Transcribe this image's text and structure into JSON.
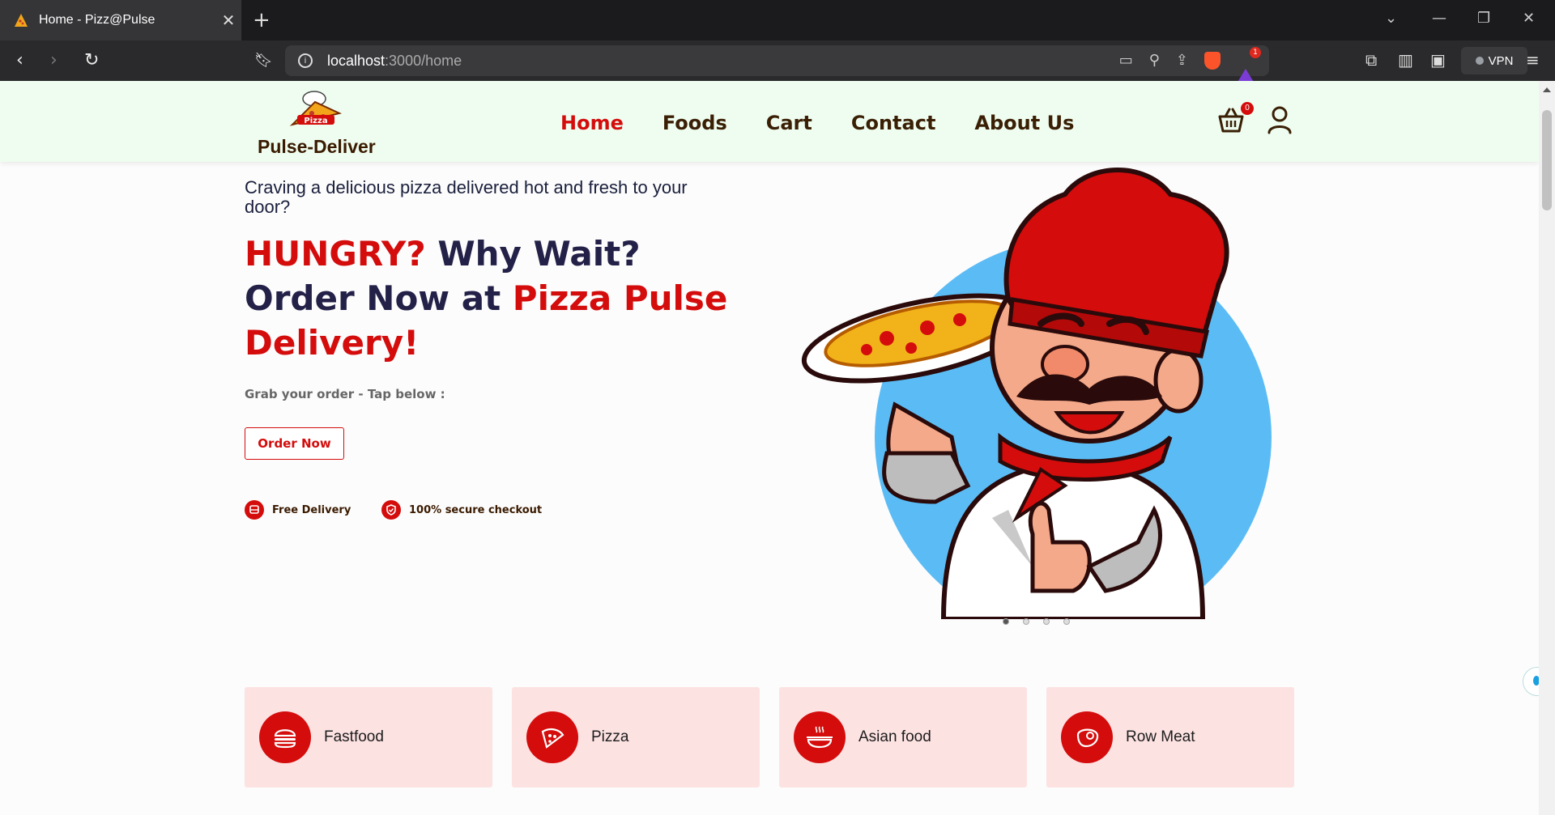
{
  "browser": {
    "tab_title": "Home - Pizz@Pulse",
    "new_tab_symbol": "+",
    "url_host": "localhost",
    "url_path": ":3000/home",
    "vpn_label": "VPN",
    "rewards_badge": "1"
  },
  "header": {
    "logo_text": "Pulse-Deliver",
    "nav": [
      {
        "label": "Home"
      },
      {
        "label": "Foods"
      },
      {
        "label": "Cart"
      },
      {
        "label": "Contact"
      },
      {
        "label": "About Us"
      }
    ],
    "cart_count": "0",
    "colors": {
      "accent": "#d40c0c",
      "header_bg": "#eefdf0",
      "dark_text": "#232148"
    }
  },
  "hero": {
    "subtitle": "Craving a delicious pizza delivered hot and fresh to your door?",
    "title_part1": "HUNGRY?",
    "title_part2": " Why Wait?",
    "title_part3": "Order Now at ",
    "title_part4": "Pizza Pulse Delivery!",
    "grab_text": "Grab your order - Tap below :",
    "order_button": "Order Now",
    "perks": [
      {
        "label": "Free Delivery",
        "icon": "delivery-icon"
      },
      {
        "label": "100% secure checkout",
        "icon": "shield-check-icon"
      }
    ],
    "carousel_slides": 4,
    "carousel_active": 1
  },
  "categories": [
    {
      "label": "Fastfood",
      "icon": "burger-icon"
    },
    {
      "label": "Pizza",
      "icon": "pizza-slice-icon"
    },
    {
      "label": "Asian food",
      "icon": "dish-icon"
    },
    {
      "label": "Row Meat",
      "icon": "meat-icon"
    }
  ]
}
